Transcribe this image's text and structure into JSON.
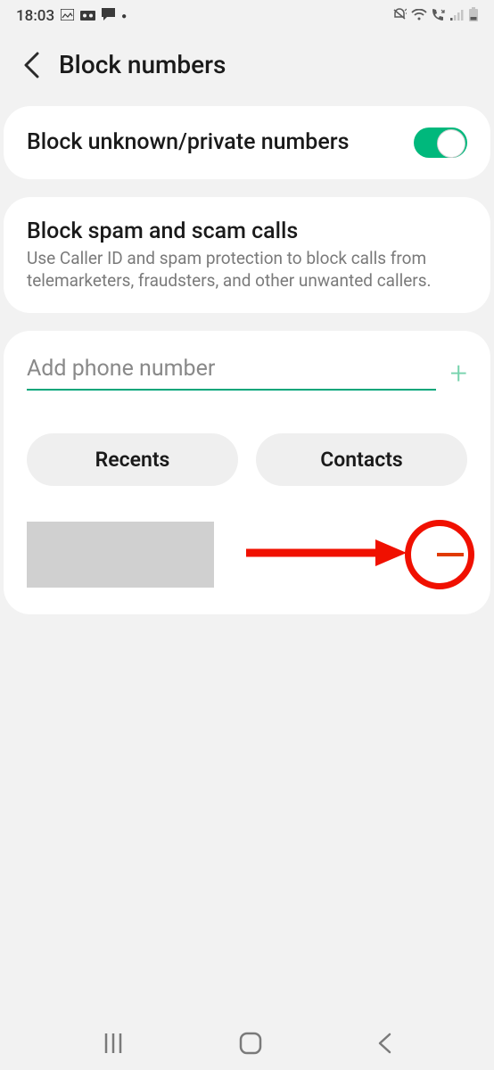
{
  "status": {
    "time": "18:03",
    "left_icons": [
      "image-icon",
      "voicemail-icon",
      "chat-icon",
      "dot-icon"
    ],
    "right_icons": [
      "vibrate-icon",
      "wifi-icon",
      "call-icon",
      "signal-icon",
      "battery-icon"
    ]
  },
  "header": {
    "title": "Block numbers"
  },
  "toggle_card": {
    "label": "Block unknown/private numbers",
    "enabled": true
  },
  "spam_card": {
    "title": "Block spam and scam calls",
    "subtitle": "Use Caller ID and spam protection to block calls from telemarketers, fraudsters, and other unwanted callers."
  },
  "add_section": {
    "placeholder": "Add phone number",
    "value": ""
  },
  "buttons": {
    "recents": "Recents",
    "contacts": "Contacts"
  }
}
